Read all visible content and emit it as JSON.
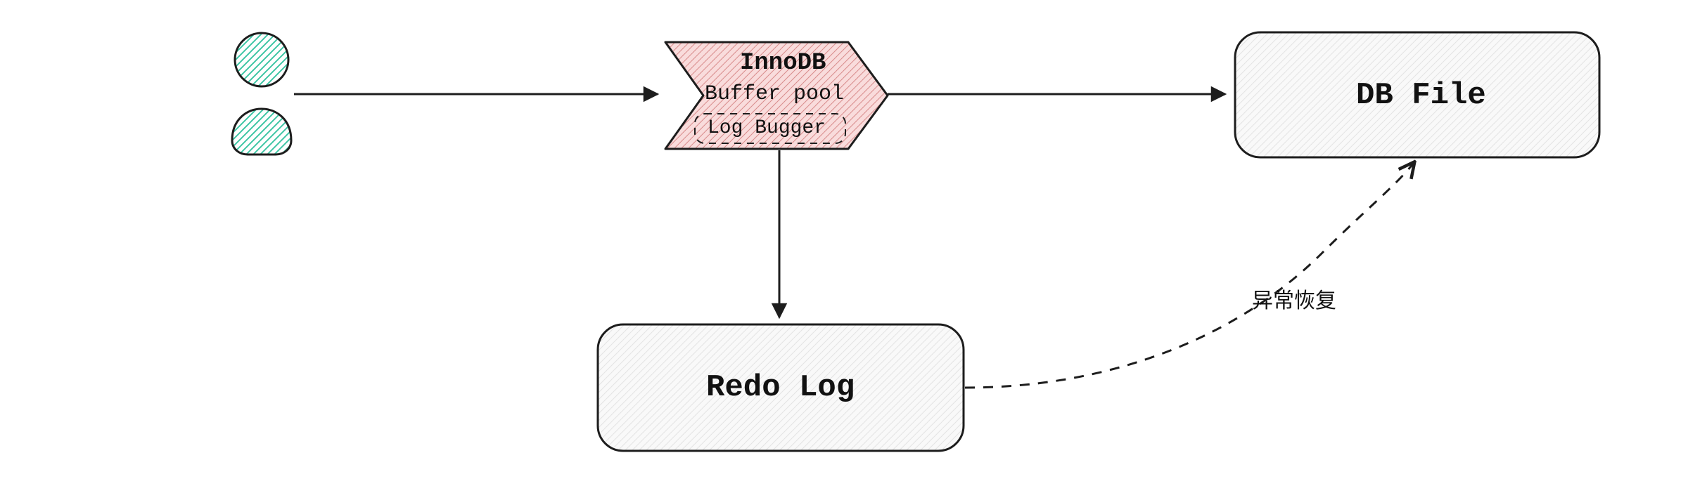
{
  "nodes": {
    "innodb": {
      "title": "InnoDB",
      "line2": "Buffer pool",
      "line3": "Log Bugger"
    },
    "dbfile": {
      "label": "DB File"
    },
    "redolog": {
      "label": "Redo Log"
    }
  },
  "edges": {
    "recovery_label": "异常恢复"
  },
  "colors": {
    "stroke": "#1d1d1d",
    "user_fill": "#3fc6a5",
    "user_stroke": "#1d1d1d",
    "innodb_fill": "#f7d7d7",
    "innodb_stroke": "#111",
    "box_fill": "#f3f3f3",
    "box_stroke": "#1d1d1d"
  }
}
